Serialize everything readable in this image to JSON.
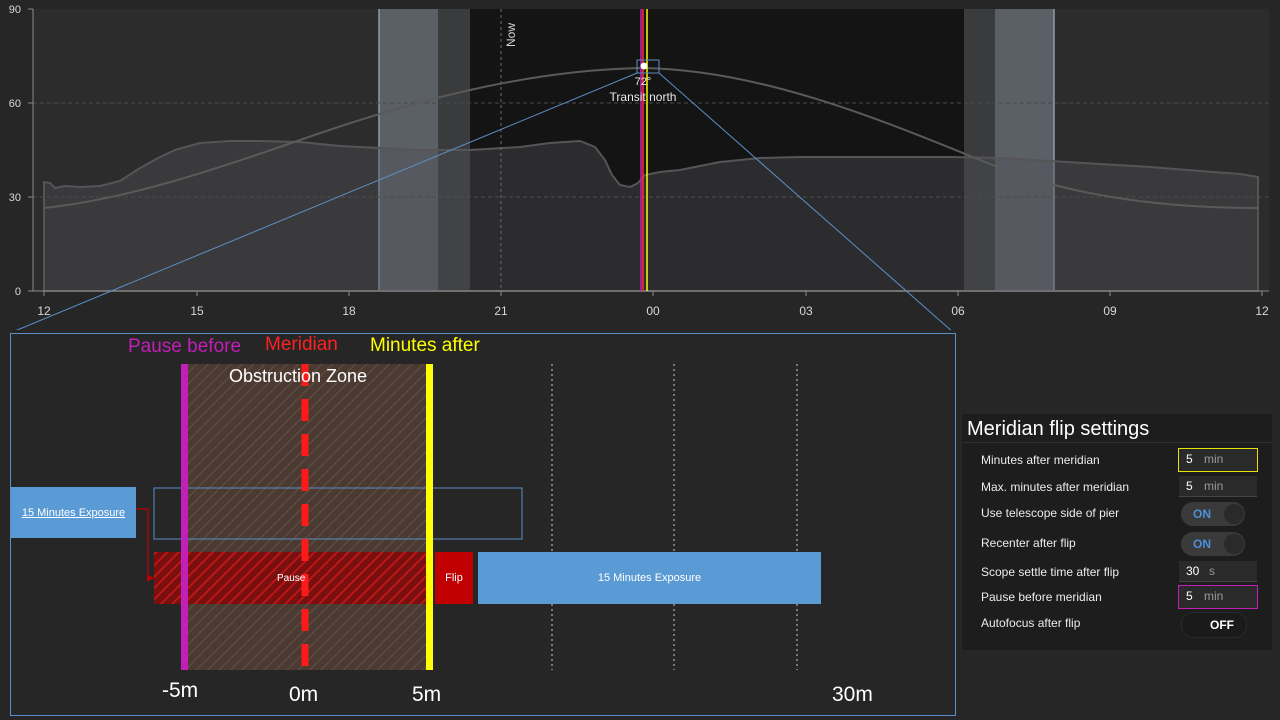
{
  "chart": {
    "y_ticks": [
      "90",
      "60",
      "30",
      "0"
    ],
    "x_ticks": [
      "12",
      "15",
      "18",
      "21",
      "00",
      "03",
      "06",
      "09",
      "12"
    ],
    "now_label": "Now",
    "transit_altitude": "72°",
    "transit_label": "Transit north"
  },
  "diagram": {
    "pause_before_label": "Pause before",
    "meridian_label": "Meridian",
    "minutes_after_label": "Minutes after",
    "obstruction_label": "Obstruction Zone",
    "exposure_left_label": "15 Minutes Exposure",
    "pause_label": "Pause",
    "flip_label": "Flip",
    "exposure_right_label": "15 Minutes Exposure",
    "time_minus5": "-5m",
    "time_0": "0m",
    "time_5": "5m",
    "time_30": "30m"
  },
  "settings": {
    "title": "Meridian flip settings",
    "minutes_after_meridian": {
      "label": "Minutes after meridian",
      "value": "5",
      "unit": "min"
    },
    "max_minutes_after": {
      "label": "Max. minutes after meridian",
      "value": "5",
      "unit": "min"
    },
    "use_side_of_pier": {
      "label": "Use telescope side of pier",
      "state": "ON"
    },
    "recenter": {
      "label": "Recenter after flip",
      "state": "ON"
    },
    "settle_time": {
      "label": "Scope settle time after flip",
      "value": "30",
      "unit": "s"
    },
    "pause_before": {
      "label": "Pause before meridian",
      "value": "5",
      "unit": "min"
    },
    "autofocus": {
      "label": "Autofocus after flip",
      "state": "OFF"
    }
  },
  "colors": {
    "pause_before": "#c21eb8",
    "meridian": "#ff1a1a",
    "minutes_after": "#ffff00",
    "exposure": "#5b9bd5",
    "flip": "#c00000",
    "zoom_outline": "#5b8fc7"
  }
}
